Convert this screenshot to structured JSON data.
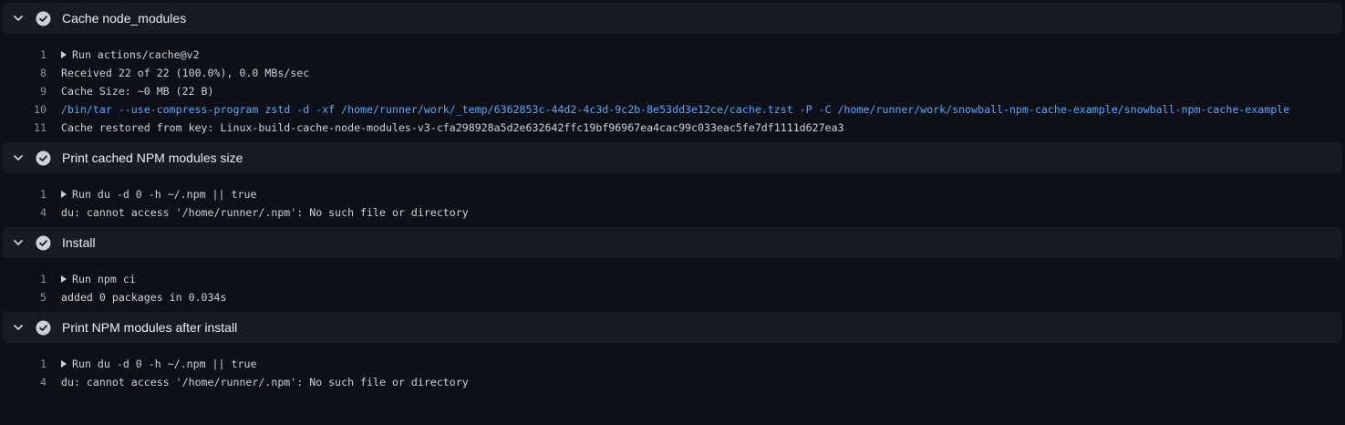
{
  "colors": {
    "background": "#0d1117",
    "header_background": "#161b22",
    "success_icon": "#c9d1d9",
    "command_text": "#58a6ff",
    "line_number": "#8b949e"
  },
  "steps": [
    {
      "title": "Cache node_modules",
      "icon": "check-circle-icon",
      "expanded": true,
      "lines": [
        {
          "num": "1",
          "text": "Run actions/cache@v2",
          "group": true
        },
        {
          "num": "8",
          "text": "Received 22 of 22 (100.0%), 0.0 MBs/sec"
        },
        {
          "num": "9",
          "text": "Cache Size: ~0 MB (22 B)"
        },
        {
          "num": "10",
          "text": "/bin/tar --use-compress-program zstd -d -xf /home/runner/work/_temp/6362853c-44d2-4c3d-9c2b-8e53dd3e12ce/cache.tzst -P -C /home/runner/work/snowball-npm-cache-example/snowball-npm-cache-example",
          "command": true
        },
        {
          "num": "11",
          "text": "Cache restored from key: Linux-build-cache-node-modules-v3-cfa298928a5d2e632642ffc19bf96967ea4cac99c033eac5fe7df1111d627ea3"
        }
      ]
    },
    {
      "title": "Print cached NPM modules size",
      "icon": "check-circle-icon",
      "expanded": true,
      "lines": [
        {
          "num": "1",
          "text": "Run du -d 0 -h ~/.npm || true",
          "group": true
        },
        {
          "num": "4",
          "text": "du: cannot access '/home/runner/.npm': No such file or directory"
        }
      ]
    },
    {
      "title": "Install",
      "icon": "check-circle-icon",
      "expanded": true,
      "lines": [
        {
          "num": "1",
          "text": "Run npm ci",
          "group": true
        },
        {
          "num": "5",
          "text": "added 0 packages in 0.034s"
        }
      ]
    },
    {
      "title": "Print NPM modules after install",
      "icon": "check-circle-icon",
      "expanded": true,
      "lines": [
        {
          "num": "1",
          "text": "Run du -d 0 -h ~/.npm || true",
          "group": true
        },
        {
          "num": "4",
          "text": "du: cannot access '/home/runner/.npm': No such file or directory"
        }
      ]
    }
  ]
}
